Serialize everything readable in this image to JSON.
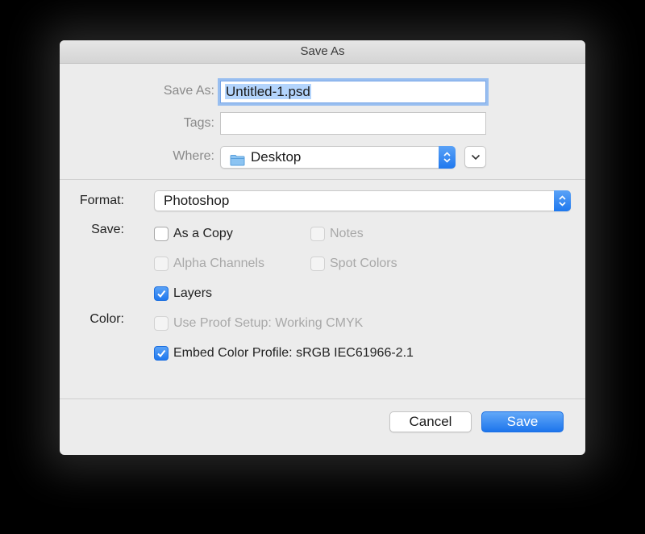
{
  "window": {
    "title": "Save As"
  },
  "top": {
    "save_as_label": "Save As:",
    "filename_value": "Untitled-1.psd",
    "tags_label": "Tags:",
    "tags_value": "",
    "where_label": "Where:",
    "where_value": "Desktop",
    "folder_icon": "folder-icon",
    "expand_icon": "chevron-down-icon"
  },
  "options": {
    "format_label": "Format:",
    "format_value": "Photoshop",
    "save_label": "Save:",
    "color_label": "Color:",
    "checkboxes": {
      "as_a_copy": {
        "label": "As a Copy",
        "checked": false,
        "enabled": true
      },
      "notes": {
        "label": "Notes",
        "checked": false,
        "enabled": false
      },
      "alpha_channels": {
        "label": "Alpha Channels",
        "checked": false,
        "enabled": false
      },
      "spot_colors": {
        "label": "Spot Colors",
        "checked": false,
        "enabled": false
      },
      "layers": {
        "label": "Layers",
        "checked": true,
        "enabled": true
      },
      "use_proof_setup": {
        "label": "Use Proof Setup:  Working CMYK",
        "checked": false,
        "enabled": false
      },
      "embed_color_profile": {
        "label": "Embed Color Profile:  sRGB IEC61966-2.1",
        "checked": true,
        "enabled": true
      }
    }
  },
  "buttons": {
    "cancel": "Cancel",
    "save": "Save"
  },
  "colors": {
    "accent": "#1f78ee",
    "selection": "#b3d4fc",
    "background": "#ececec"
  }
}
